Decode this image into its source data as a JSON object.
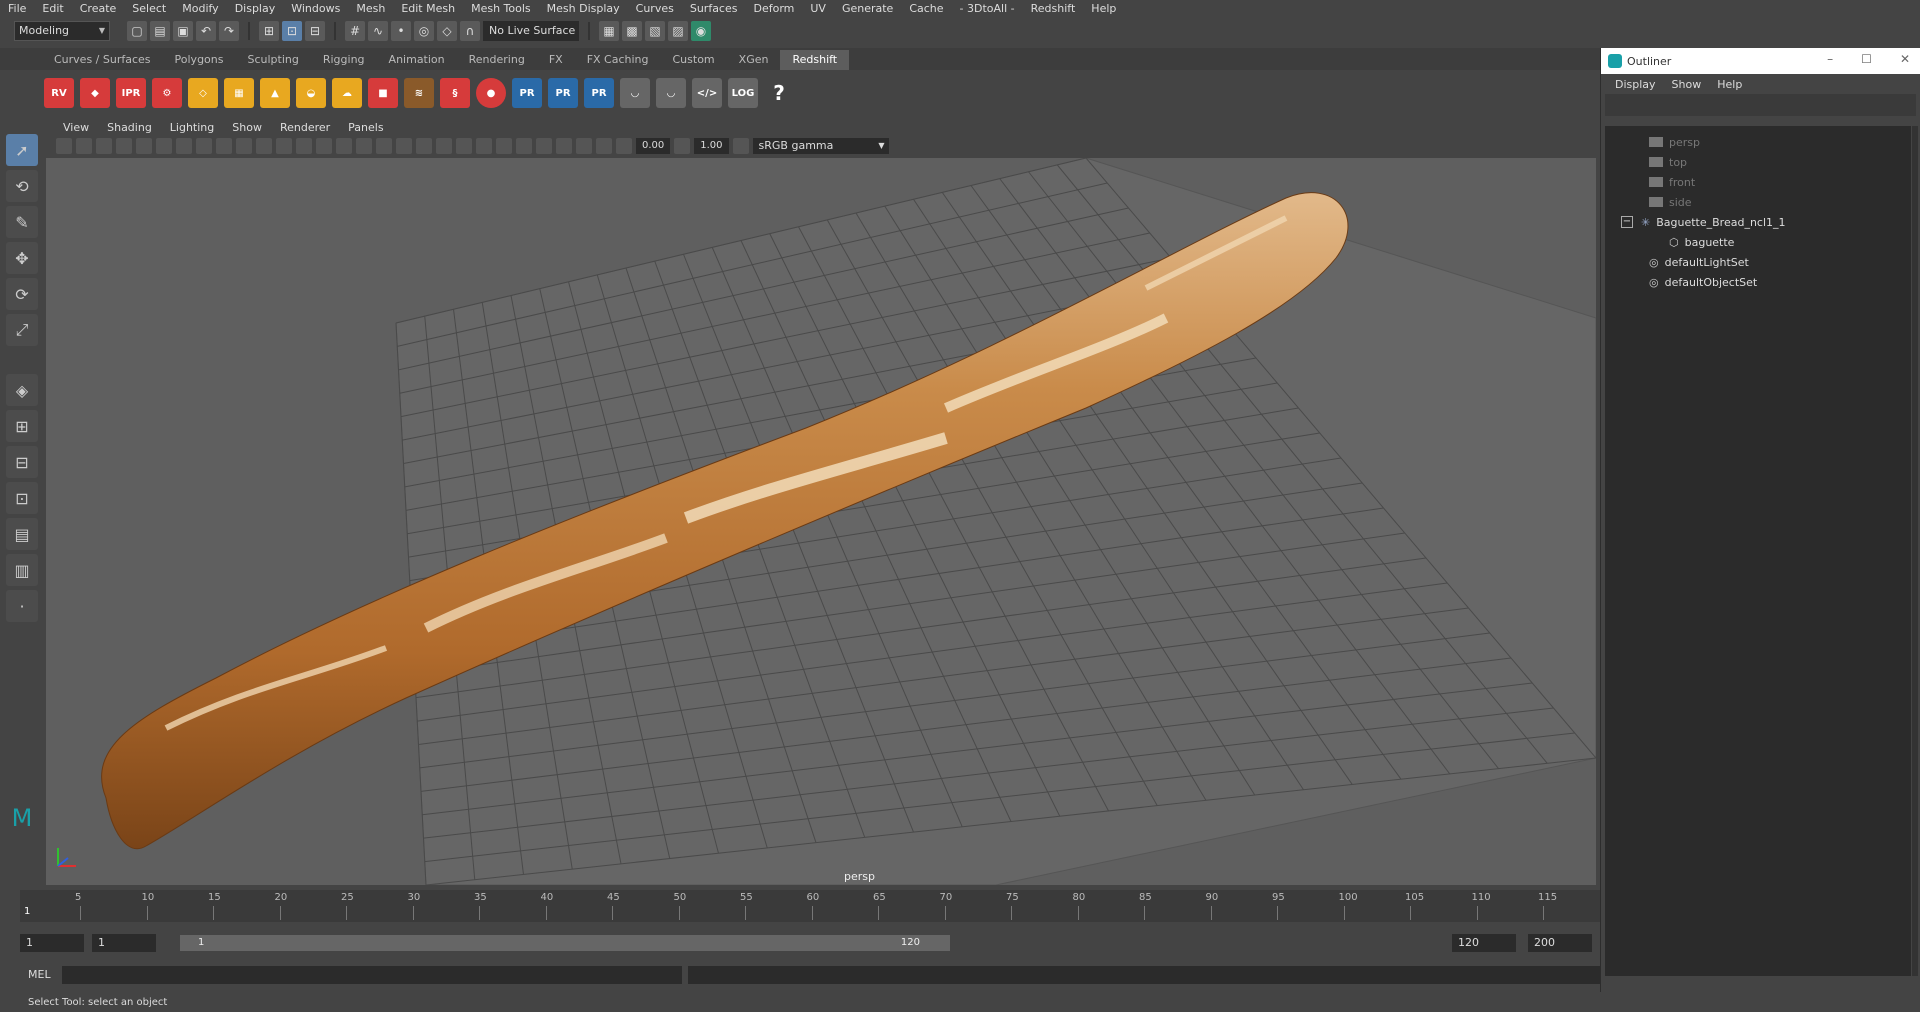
{
  "menubar": [
    "File",
    "Edit",
    "Create",
    "Select",
    "Modify",
    "Display",
    "Windows",
    "Mesh",
    "Edit Mesh",
    "Mesh Tools",
    "Mesh Display",
    "Curves",
    "Surfaces",
    "Deform",
    "UV",
    "Generate",
    "Cache",
    "- 3DtoAll -",
    "Redshift",
    "Help"
  ],
  "status": {
    "mode": "Modeling",
    "live_surface": "No Live Surface"
  },
  "shelf_tabs": [
    "Curves / Surfaces",
    "Polygons",
    "Sculpting",
    "Rigging",
    "Animation",
    "Rendering",
    "FX",
    "FX Caching",
    "Custom",
    "XGen",
    "Redshift"
  ],
  "shelf_active": "Redshift",
  "shelf_icons": {
    "rv": "RV",
    "ipr": "IPR",
    "pr": "PR",
    "log": "LOG",
    "help": "?"
  },
  "viewport_menu": [
    "View",
    "Shading",
    "Lighting",
    "Show",
    "Renderer",
    "Panels"
  ],
  "viewport_toolbar": {
    "exposure": "0.00",
    "gamma": "1.00",
    "color_space": "sRGB gamma"
  },
  "viewport": {
    "camera": "persp"
  },
  "timeline": {
    "ticks": [
      "5",
      "10",
      "15",
      "20",
      "25",
      "30",
      "35",
      "40",
      "45",
      "50",
      "55",
      "60",
      "65",
      "70",
      "75",
      "80",
      "85",
      "90",
      "95",
      "100",
      "105",
      "110",
      "115"
    ],
    "current": "1"
  },
  "range": {
    "start": "1",
    "playback_start": "1",
    "slider_start": "1",
    "slider_end": "120",
    "playback_end": "120",
    "end": "200"
  },
  "command_line": {
    "label": "MEL"
  },
  "help_line": "Select Tool: select an object",
  "outliner": {
    "title": "Outliner",
    "menu": [
      "Display",
      "Show",
      "Help"
    ],
    "items": [
      {
        "label": "persp",
        "dim": true
      },
      {
        "label": "top",
        "dim": true
      },
      {
        "label": "front",
        "dim": true
      },
      {
        "label": "side",
        "dim": true
      },
      {
        "label": "Baguette_Bread_ncl1_1",
        "dim": false
      },
      {
        "label": "baguette",
        "dim": false
      },
      {
        "label": "defaultLightSet",
        "dim": false
      },
      {
        "label": "defaultObjectSet",
        "dim": false
      }
    ]
  }
}
